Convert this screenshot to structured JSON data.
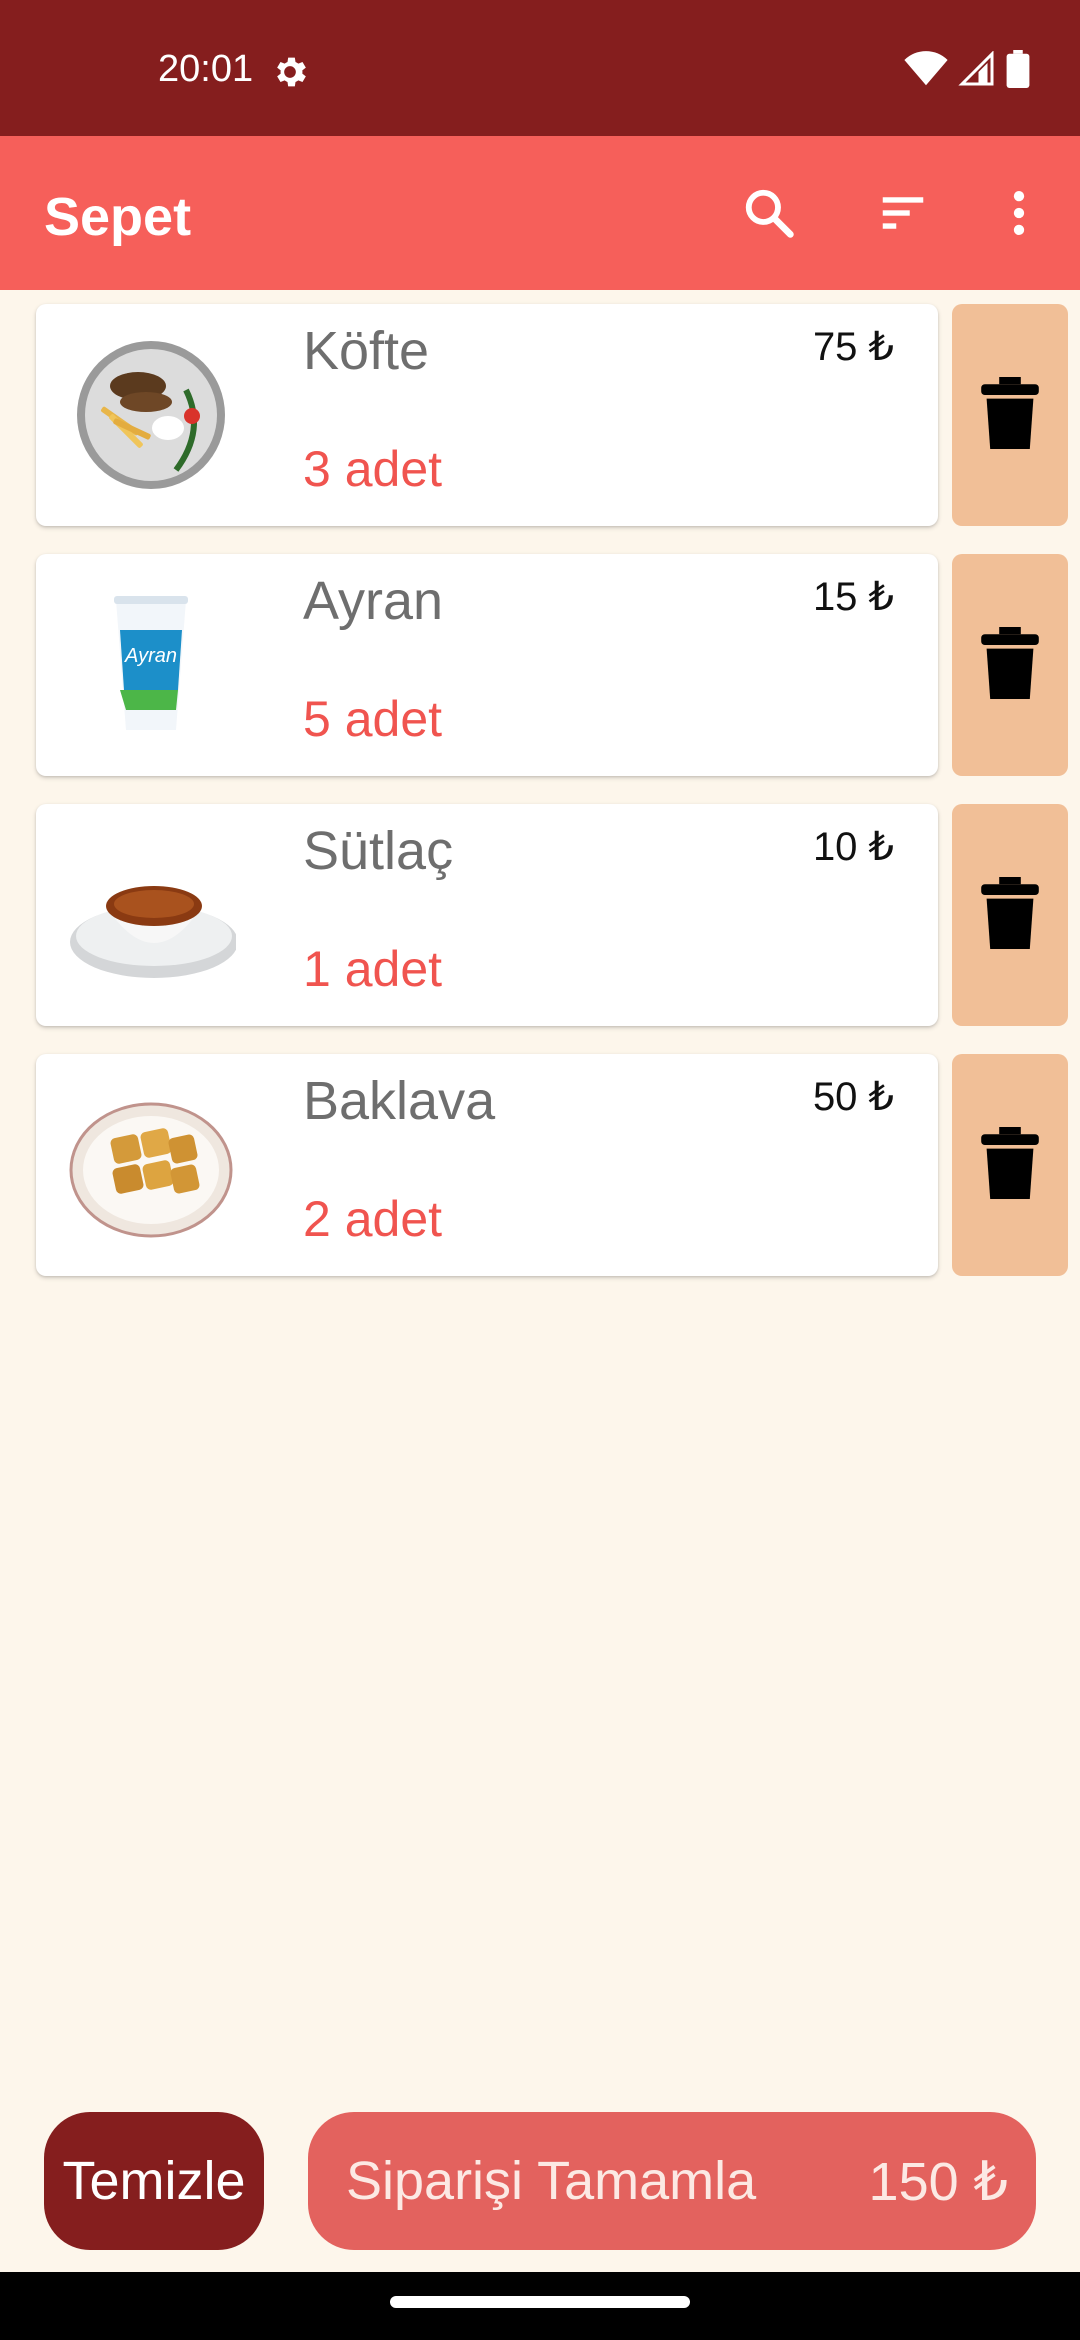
{
  "status_bar": {
    "time": "20:01"
  },
  "app_bar": {
    "title": "Sepet",
    "actions": [
      "search-icon",
      "sort-icon",
      "more-vert-icon"
    ]
  },
  "cart": {
    "items": [
      {
        "name": "Köfte",
        "quantity": "3 adet",
        "price": "75 ₺",
        "image": "kofte-plate"
      },
      {
        "name": "Ayran",
        "quantity": "5 adet",
        "price": "15 ₺",
        "image": "ayran-cup"
      },
      {
        "name": "Sütlaç",
        "quantity": "1 adet",
        "price": "10 ₺",
        "image": "sutlac-bowl"
      },
      {
        "name": "Baklava",
        "quantity": "2 adet",
        "price": "50 ₺",
        "image": "baklava-plate"
      }
    ]
  },
  "bottom": {
    "clear_label": "Temizle",
    "checkout_label": "Siparişi Tamamla",
    "total": "150 ₺"
  },
  "colors": {
    "status_bar": "#851E1E",
    "app_bar": "#F65F5A",
    "background": "#FDF6EB",
    "delete_button": "#F1BF97",
    "quantity_text": "#F0544F",
    "clear_button": "#851E1E",
    "checkout_button": "#E3625E"
  }
}
